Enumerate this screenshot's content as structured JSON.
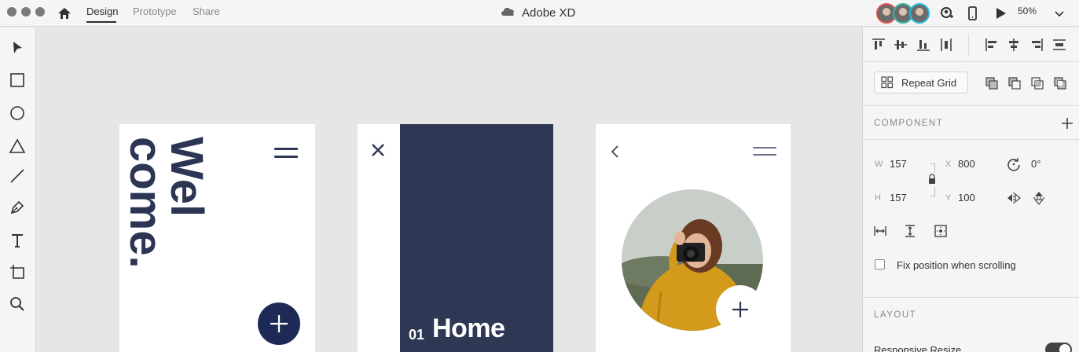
{
  "titlebar": {
    "tabs": [
      {
        "label": "Design",
        "active": true
      },
      {
        "label": "Prototype",
        "active": false
      },
      {
        "label": "Share",
        "active": false
      }
    ],
    "doc_title": "Adobe XD",
    "zoom": "50%",
    "avatar_ring_colors": [
      "#e0524a",
      "#34b8a0",
      "#2bb6d6"
    ]
  },
  "tools": [
    "select-tool",
    "rectangle-tool",
    "ellipse-tool",
    "polygon-tool",
    "line-tool",
    "pen-tool",
    "text-tool",
    "artboard-tool",
    "zoom-tool"
  ],
  "artboards": {
    "welcome": {
      "heading": "Wel\ncome.",
      "line1": "Wel",
      "line2": "come.",
      "fab": "+"
    },
    "menu": {
      "number": "01",
      "label": "Home"
    },
    "profile": {
      "add": "+"
    }
  },
  "colors": {
    "navy": "#2e3754",
    "fab": "#1e2a56",
    "accent_text": "#2d3555"
  },
  "panel": {
    "repeat_grid_label": "Repeat Grid",
    "component_heading": "COMPONENT",
    "w_label": "W",
    "w_value": "157",
    "x_label": "X",
    "x_value": "800",
    "h_label": "H",
    "h_value": "157",
    "y_label": "Y",
    "y_value": "100",
    "rotation": "0°",
    "fix_position_label": "Fix position when scrolling",
    "fix_position_checked": false,
    "layout_heading": "LAYOUT",
    "responsive_resize_label": "Responsive Resize",
    "responsive_resize_on": true
  }
}
